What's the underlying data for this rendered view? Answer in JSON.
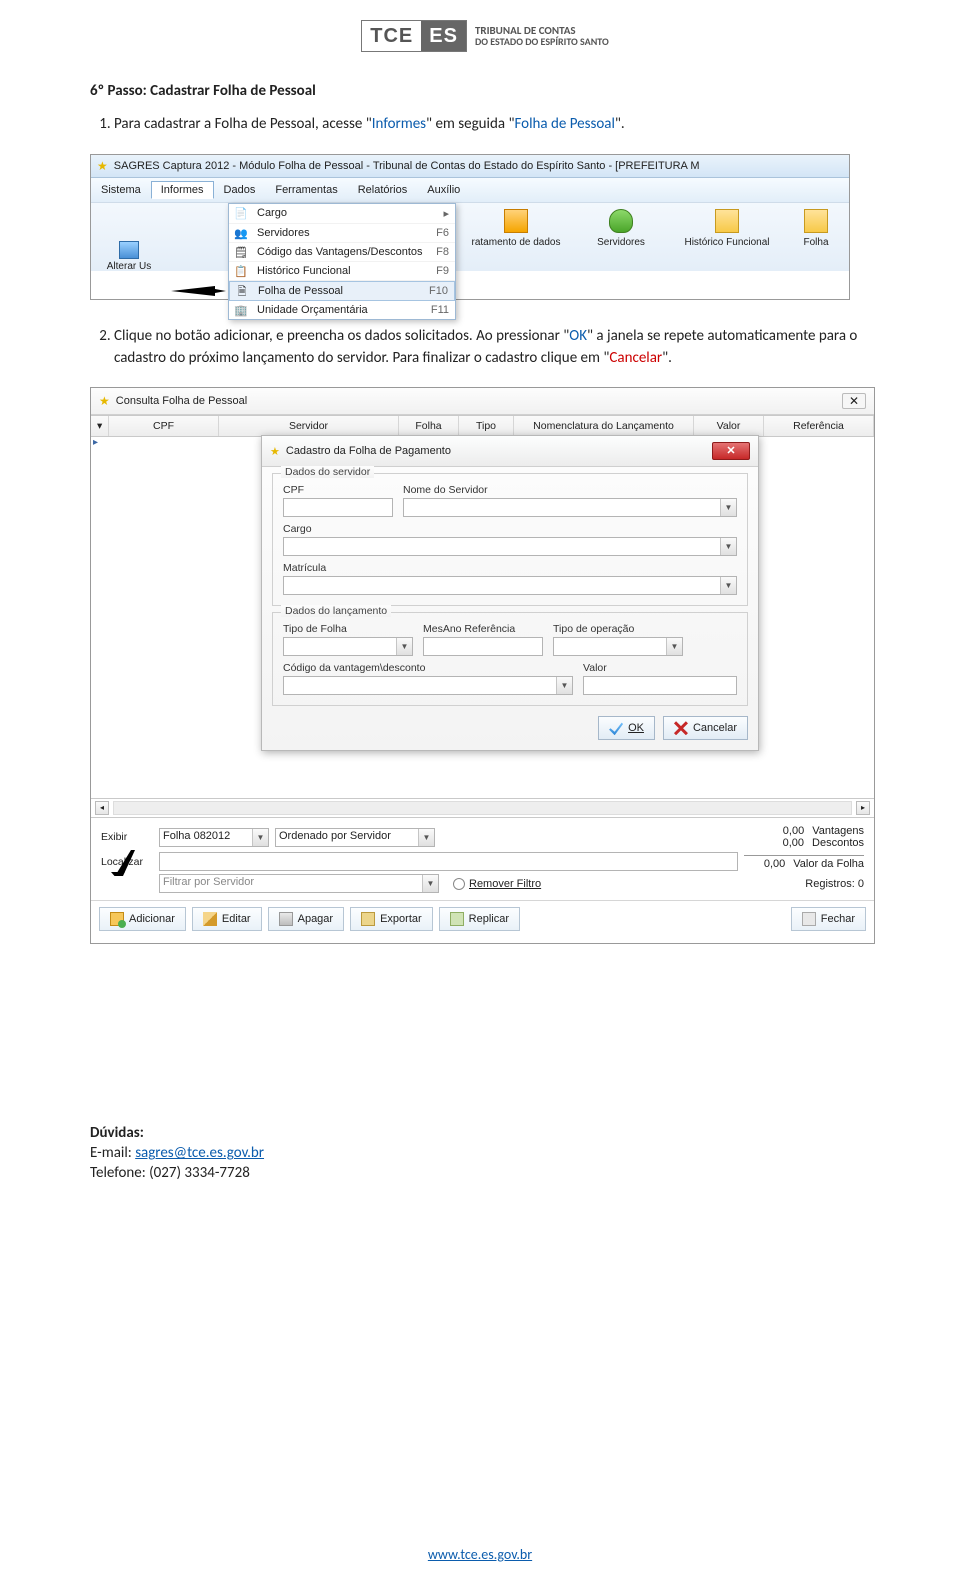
{
  "logo": {
    "left": "TCE",
    "right": "ES",
    "line1": "TRIBUNAL DE CONTAS",
    "line2": "DO ESTADO DO ESPÍRITO SANTO"
  },
  "step_title": "6º Passo: Cadastrar Folha de Pessoal",
  "step1_pre": "Para cadastrar a Folha de Pessoal, acesse \"",
  "step1_link1": "Informes",
  "step1_mid": "\" em seguida \"",
  "step1_link2": "Folha de Pessoal",
  "step1_post": "\".",
  "step2_a": "Clique no botão adicionar, e preencha os dados solicitados. Ao pressionar \"",
  "step2_ok": "OK",
  "step2_b": "\" a janela se repete automaticamente para o cadastro do próximo lançamento do servidor. Para finalizar o cadastro clique em \"",
  "step2_cancel": "Cancelar",
  "step2_c": "\".",
  "shot1": {
    "title": "SAGRES Captura 2012 - Módulo Folha de Pessoal - Tribunal de Contas do Estado do Espírito Santo - [PREFEITURA M",
    "menus": [
      "Sistema",
      "Informes",
      "Dados",
      "Ferramentas",
      "Relatórios",
      "Auxílio"
    ],
    "alterar": "Alterar Us",
    "tool_trat": "ratamento de dados",
    "tool_serv": "Servidores",
    "tool_hist": "Histórico Funcional",
    "tool_folha": "Folha",
    "dropdown": [
      {
        "label": "Cargo",
        "shortcut": "",
        "arrow": true
      },
      {
        "label": "Servidores",
        "shortcut": "F6",
        "arrow": false
      },
      {
        "label": "Código das Vantagens/Descontos",
        "shortcut": "F8",
        "arrow": false
      },
      {
        "label": "Histórico Funcional",
        "shortcut": "F9",
        "arrow": false
      },
      {
        "label": "Folha de Pessoal",
        "shortcut": "F10",
        "arrow": false
      },
      {
        "label": "Unidade Orçamentária",
        "shortcut": "F11",
        "arrow": false
      }
    ]
  },
  "shot2": {
    "outer_title": "Consulta Folha de Pessoal",
    "headers": {
      "cpf": "CPF",
      "serv": "Servidor",
      "folha": "Folha",
      "tipo": "Tipo",
      "nom": "Nomenclatura do Lançamento",
      "valor": "Valor",
      "ref": "Referência"
    },
    "dialog": {
      "title": "Cadastro da Folha de Pagamento",
      "g1": "Dados do servidor",
      "cpf": "CPF",
      "nome": "Nome do Servidor",
      "cargo": "Cargo",
      "matricula": "Matrícula",
      "g2": "Dados do lançamento",
      "tipo_folha": "Tipo de Folha",
      "mesano": "MesAno Referência",
      "tipo_op": "Tipo de operação",
      "codigo": "Código da vantagem\\desconto",
      "valor": "Valor",
      "ok": "OK",
      "cancel": "Cancelar"
    },
    "bottom": {
      "exibir": "Exibir",
      "exibir_val": "Folha 082012",
      "orden": "Ordenado por Servidor",
      "localizar": "Localizar",
      "filtrar_placeholder": "Filtrar por Servidor",
      "remover": "Remover Filtro",
      "vant_v": "0,00",
      "vant_l": "Vantagens",
      "desc_v": "0,00",
      "desc_l": "Descontos",
      "vf_v": "0,00",
      "vf_l": "Valor da Folha",
      "reg": "Registros: 0"
    },
    "buttons": {
      "adicionar": "Adicionar",
      "editar": "Editar",
      "apagar": "Apagar",
      "exportar": "Exportar",
      "replicar": "Replicar",
      "fechar": "Fechar"
    }
  },
  "duvidas": {
    "title": "Dúvidas:",
    "email_label": "E-mail: ",
    "email": "sagres@tce.es.gov.br",
    "tel": "Telefone: (027) 3334-7728"
  },
  "footer": "www.tce.es.gov.br"
}
